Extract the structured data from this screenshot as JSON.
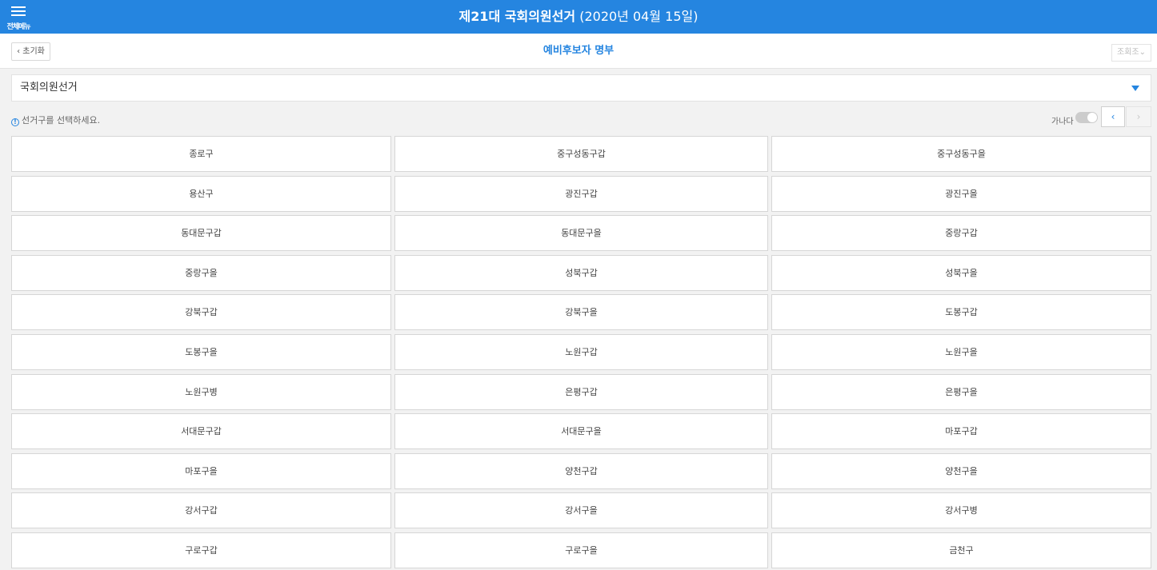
{
  "header": {
    "menu_label": "전체메뉴",
    "title_bold": "제21대 국회의원선거",
    "title_date": "(2020년 04월 15일)"
  },
  "subheader": {
    "reset_label": "초기화",
    "page_title": "예비후보자 명부",
    "lookup_label": "조회조"
  },
  "election_select": {
    "selected": "국회의원선거"
  },
  "info": {
    "message": "선거구를 선택하세요.",
    "sort_label": "가나다",
    "prev_glyph": "‹",
    "next_glyph": "›"
  },
  "districts": [
    "종로구",
    "중구성동구갑",
    "중구성동구을",
    "용산구",
    "광진구갑",
    "광진구을",
    "동대문구갑",
    "동대문구을",
    "중랑구갑",
    "중랑구을",
    "성북구갑",
    "성북구을",
    "강북구갑",
    "강북구을",
    "도봉구갑",
    "도봉구을",
    "노원구갑",
    "노원구을",
    "노원구병",
    "은평구갑",
    "은평구을",
    "서대문구갑",
    "서대문구을",
    "마포구갑",
    "마포구을",
    "양천구갑",
    "양천구을",
    "강서구갑",
    "강서구을",
    "강서구병",
    "구로구갑",
    "구로구을",
    "금천구"
  ],
  "colors": {
    "accent": "#2585e0"
  }
}
